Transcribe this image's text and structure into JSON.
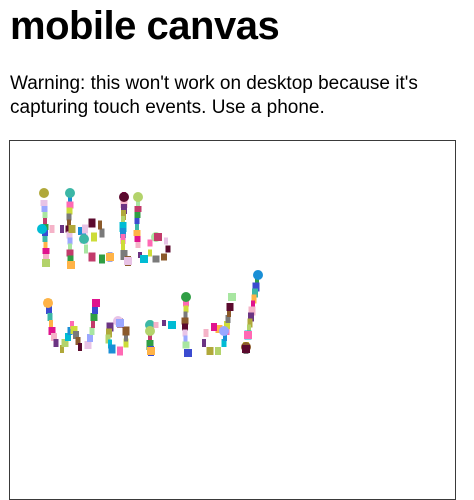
{
  "page": {
    "title": "mobile canvas",
    "warning": "Warning: this won't work on desktop because it's capturing touch events. Use a phone."
  },
  "drawing": {
    "description_free_text": "",
    "palette": [
      "#5b0a2e",
      "#a8e6a1",
      "#3b4bd0",
      "#e0138e",
      "#b0a83a",
      "#1a8fd6",
      "#7a7a7a",
      "#e8c3e6",
      "#c23b6b",
      "#3cb7a6",
      "#f5b3c8",
      "#b3d36b",
      "#ff69b4",
      "#8b5a2b",
      "#9aa7ff",
      "#2f9e44",
      "#ffb347",
      "#6c3483",
      "#00bcd4",
      "#cddc39"
    ]
  }
}
